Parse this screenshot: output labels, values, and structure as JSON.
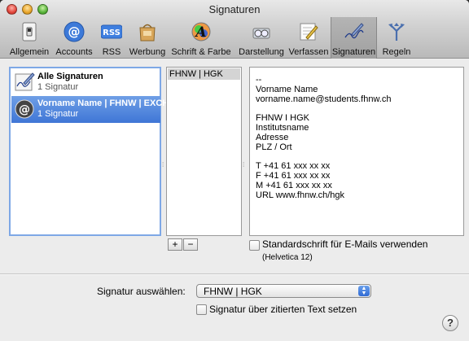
{
  "window": {
    "title": "Signaturen"
  },
  "toolbar": {
    "items": [
      {
        "label": "Allgemein",
        "icon": "light-switch-icon"
      },
      {
        "label": "Accounts",
        "icon": "at-sign-icon"
      },
      {
        "label": "RSS",
        "icon": "rss-icon"
      },
      {
        "label": "Werbung",
        "icon": "junk-bag-icon"
      },
      {
        "label": "Schrift & Farbe",
        "icon": "font-color-icon"
      },
      {
        "label": "Darstellung",
        "icon": "eyeglasses-icon"
      },
      {
        "label": "Verfassen",
        "icon": "pencil-note-icon"
      },
      {
        "label": "Signaturen",
        "icon": "signature-pen-icon"
      },
      {
        "label": "Regeln",
        "icon": "rules-arrows-icon"
      }
    ],
    "selected": "Signaturen"
  },
  "accounts": [
    {
      "name": "Alle Signaturen",
      "count": "1 Signatur",
      "icon": "signature-icon",
      "selected": false
    },
    {
      "name": "Vorname Name | FHNW | EXCH",
      "count": "1 Signatur",
      "icon": "at-sign-icon",
      "selected": true
    }
  ],
  "signatures": [
    "FHNW | HGK"
  ],
  "signature_text": "--\nVorname Name\nvorname.name@students.fhnw.ch\n\nFHNW I HGK\nInstitutsname\nAdresse\nPLZ / Ort\n\nT +41 61 xxx xx xx\nF +41 61 xxx xx xx\nM +41 61 xxx xx xx\nURL www.fhnw.ch/hgk",
  "buttons": {
    "add": "+",
    "remove": "−"
  },
  "default_font": {
    "label": "Standardschrift für E-Mails verwenden",
    "hint": "(Helvetica 12)",
    "checked": false
  },
  "choose": {
    "label": "Signatur auswählen:",
    "value": "FHNW | HGK"
  },
  "above_quote": {
    "label": "Signatur über zitierten Text setzen",
    "checked": false
  },
  "help": "?",
  "colors": {
    "selection": "#3f76d6",
    "accent": "#2f6ad3"
  }
}
